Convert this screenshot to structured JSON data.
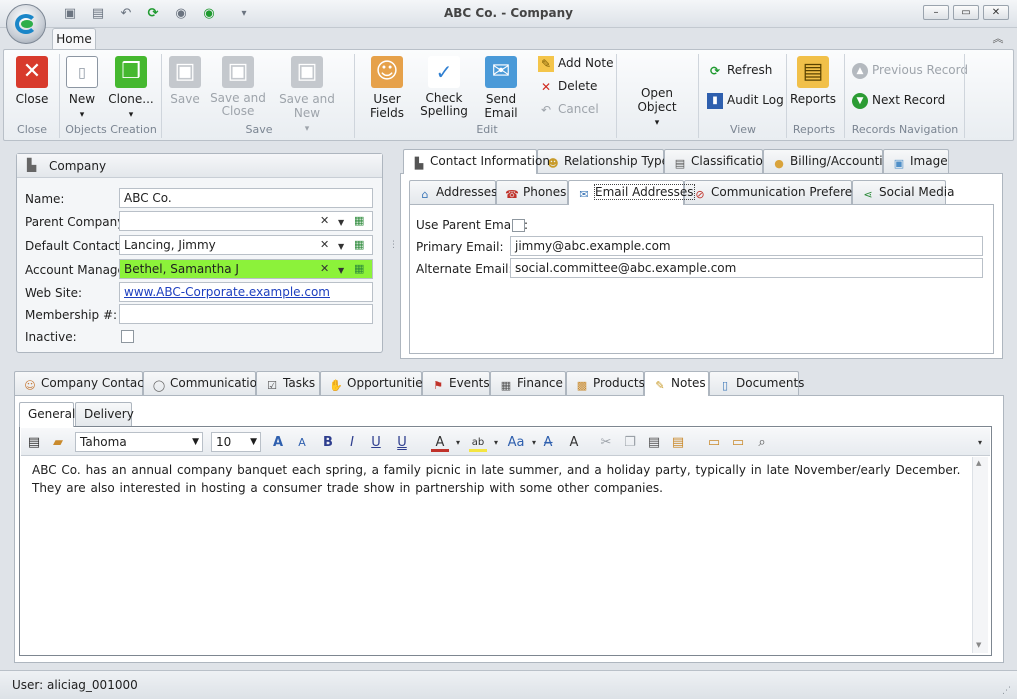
{
  "window": {
    "title": "ABC Co. - Company",
    "controls": [
      "–",
      "▭",
      "✕"
    ]
  },
  "quick_access": [
    "save-icon",
    "save-all-icon",
    "undo-icon",
    "refresh-icon",
    "back-icon",
    "forward-icon",
    "customize-icon"
  ],
  "ribbon": {
    "tab": "Home",
    "buttons": {
      "close": "Close",
      "new": "New",
      "clone": "Clone...",
      "save": "Save",
      "save_close": "Save and Close",
      "save_new": "Save and New",
      "user_fields": "User Fields",
      "check_spelling": "Check Spelling",
      "send_email": "Send Email",
      "add_note": "Add Note",
      "delete": "Delete",
      "cancel": "Cancel",
      "open_object": "Open Object",
      "refresh": "Refresh",
      "audit_log": "Audit Log",
      "reports": "Reports",
      "previous_record": "Previous Record",
      "next_record": "Next Record"
    },
    "groups": {
      "close": "Close",
      "objects_creation": "Objects Creation",
      "save": "Save",
      "edit": "Edit",
      "view": "View",
      "reports": "Reports",
      "records_navigation": "Records Navigation"
    }
  },
  "company_panel": {
    "header": "Company",
    "labels": {
      "name": "Name:",
      "parent_company": "Parent Company:",
      "default_contact": "Default Contact:",
      "account_manager": "Account Manager:",
      "web_site": "Web Site:",
      "membership": "Membership #:",
      "inactive": "Inactive:"
    },
    "values": {
      "name": "ABC Co.",
      "parent_company": "",
      "default_contact": "Lancing, Jimmy",
      "account_manager": "Bethel, Samantha J",
      "web_site": "www.ABC-Corporate.example.com",
      "membership": ""
    },
    "highlight_color": "#8cf23a"
  },
  "contact_tabs": {
    "tabs": [
      "Contact Information",
      "Relationship Types",
      "Classification",
      "Billing/Accounting",
      "Image"
    ],
    "subtabs": [
      "Addresses",
      "Phones",
      "Email Addresses",
      "Communication Preferences",
      "Social Media"
    ],
    "email": {
      "use_parent_label": "Use Parent Emails:",
      "primary_label": "Primary Email:",
      "primary_value": "jimmy@abc.example.com",
      "alternate_label": "Alternate Email:",
      "alternate_value": "social.committee@abc.example.com"
    }
  },
  "bottom_tabs": {
    "tabs": [
      "Company Contacts",
      "Communications",
      "Tasks",
      "Opportunities",
      "Events",
      "Finance",
      "Products",
      "Notes",
      "Documents"
    ],
    "subtabs": [
      "General",
      "Delivery"
    ]
  },
  "editor": {
    "font": "Tahoma",
    "size": "10",
    "text": "ABC Co. has an annual company banquet each spring, a family picnic in late summer, and a holiday party, typically in late November/early December.  They are also interested in hosting a consumer trade show in partnership with some other companies."
  },
  "status": {
    "user": "User: aliciag_001000"
  }
}
